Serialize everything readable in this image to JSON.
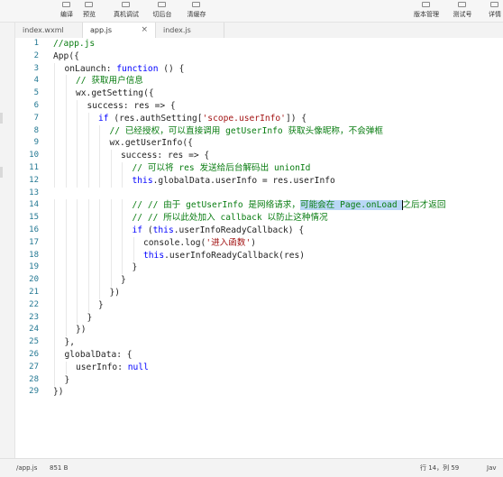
{
  "toolbar": {
    "left": [
      {
        "label": "编译",
        "icon": "compile-icon"
      },
      {
        "label": "预览",
        "icon": "preview-icon"
      },
      {
        "label": "真机调试",
        "icon": "debug-icon"
      },
      {
        "label": "切后台",
        "icon": "background-icon"
      },
      {
        "label": "清缓存",
        "icon": "clear-cache-icon"
      }
    ],
    "right": [
      {
        "label": "版本管理",
        "icon": "version-icon"
      },
      {
        "label": "测试号",
        "icon": "test-account-icon"
      },
      {
        "label": "详情",
        "icon": "details-icon"
      }
    ]
  },
  "tabs": [
    {
      "label": "index.wxml",
      "active": false
    },
    {
      "label": "app.js",
      "active": true,
      "close": "×"
    },
    {
      "label": "index.js",
      "active": false
    }
  ],
  "editor": {
    "lines": [
      {
        "n": "1",
        "indent": 0,
        "tokens": [
          {
            "t": "//app.js",
            "c": "comment"
          }
        ]
      },
      {
        "n": "2",
        "indent": 0,
        "tokens": [
          {
            "t": "App({",
            "c": "plain"
          }
        ]
      },
      {
        "n": "3",
        "indent": 1,
        "tokens": [
          {
            "t": "onLaunch: ",
            "c": "plain"
          },
          {
            "t": "function",
            "c": "keyword"
          },
          {
            "t": " () {",
            "c": "plain"
          }
        ]
      },
      {
        "n": "4",
        "indent": 2,
        "tokens": [
          {
            "t": "// 获取用户信息",
            "c": "comment"
          }
        ]
      },
      {
        "n": "5",
        "indent": 2,
        "tokens": [
          {
            "t": "wx.getSetting({",
            "c": "plain"
          }
        ]
      },
      {
        "n": "6",
        "indent": 3,
        "tokens": [
          {
            "t": "success: res => {",
            "c": "plain"
          }
        ]
      },
      {
        "n": "7",
        "indent": 4,
        "tokens": [
          {
            "t": "if",
            "c": "keyword"
          },
          {
            "t": " (res.authSetting[",
            "c": "plain"
          },
          {
            "t": "'scope.userInfo'",
            "c": "string"
          },
          {
            "t": "]) {",
            "c": "plain"
          }
        ]
      },
      {
        "n": "8",
        "indent": 5,
        "tokens": [
          {
            "t": "// 已经授权，可以直接调用 getUserInfo 获取头像昵称，不会弹框",
            "c": "comment"
          }
        ]
      },
      {
        "n": "9",
        "indent": 5,
        "tokens": [
          {
            "t": "wx.getUserInfo({",
            "c": "plain"
          }
        ]
      },
      {
        "n": "10",
        "indent": 6,
        "tokens": [
          {
            "t": "success: res => {",
            "c": "plain"
          }
        ]
      },
      {
        "n": "11",
        "indent": 7,
        "tokens": [
          {
            "t": "// 可以将 res 发送给后台解码出 unionId",
            "c": "comment"
          }
        ]
      },
      {
        "n": "12",
        "indent": 7,
        "tokens": [
          {
            "t": "this",
            "c": "keyword"
          },
          {
            "t": ".globalData.userInfo = res.userInfo",
            "c": "plain"
          }
        ]
      },
      {
        "n": "13",
        "indent": 0,
        "tokens": []
      },
      {
        "n": "14",
        "indent": 7,
        "tokens": [
          {
            "t": "// // 由于 getUserInfo 是网络请求，",
            "c": "comment"
          },
          {
            "t": "可能会在 Page.onLoad ",
            "c": "comment",
            "hl": true
          },
          {
            "caret": true
          },
          {
            "t": "之后才返回",
            "c": "comment"
          }
        ]
      },
      {
        "n": "15",
        "indent": 7,
        "tokens": [
          {
            "t": "// // 所以此处加入 callback 以防止这种情况",
            "c": "comment"
          }
        ]
      },
      {
        "n": "16",
        "indent": 7,
        "tokens": [
          {
            "t": "if",
            "c": "keyword"
          },
          {
            "t": " (",
            "c": "plain"
          },
          {
            "t": "this",
            "c": "keyword"
          },
          {
            "t": ".userInfoReadyCallback) {",
            "c": "plain"
          }
        ]
      },
      {
        "n": "17",
        "indent": 8,
        "tokens": [
          {
            "t": "console.log(",
            "c": "plain"
          },
          {
            "t": "'进入函数'",
            "c": "string"
          },
          {
            "t": ")",
            "c": "plain"
          }
        ]
      },
      {
        "n": "18",
        "indent": 8,
        "tokens": [
          {
            "t": "this",
            "c": "keyword"
          },
          {
            "t": ".userInfoReadyCallback(res)",
            "c": "plain"
          }
        ]
      },
      {
        "n": "19",
        "indent": 7,
        "tokens": [
          {
            "t": "}",
            "c": "plain"
          }
        ]
      },
      {
        "n": "20",
        "indent": 6,
        "tokens": [
          {
            "t": "}",
            "c": "plain"
          }
        ]
      },
      {
        "n": "21",
        "indent": 5,
        "tokens": [
          {
            "t": "})",
            "c": "plain"
          }
        ]
      },
      {
        "n": "22",
        "indent": 4,
        "tokens": [
          {
            "t": "}",
            "c": "plain"
          }
        ]
      },
      {
        "n": "23",
        "indent": 3,
        "tokens": [
          {
            "t": "}",
            "c": "plain"
          }
        ]
      },
      {
        "n": "24",
        "indent": 2,
        "tokens": [
          {
            "t": "})",
            "c": "plain"
          }
        ]
      },
      {
        "n": "25",
        "indent": 1,
        "tokens": [
          {
            "t": "},",
            "c": "plain"
          }
        ]
      },
      {
        "n": "26",
        "indent": 1,
        "tokens": [
          {
            "t": "globalData: {",
            "c": "plain"
          }
        ]
      },
      {
        "n": "27",
        "indent": 2,
        "tokens": [
          {
            "t": "userInfo: ",
            "c": "plain"
          },
          {
            "t": "null",
            "c": "keyword"
          }
        ]
      },
      {
        "n": "28",
        "indent": 1,
        "tokens": [
          {
            "t": "}",
            "c": "plain"
          }
        ]
      },
      {
        "n": "29",
        "indent": 0,
        "tokens": [
          {
            "t": "})",
            "c": "plain"
          }
        ]
      }
    ]
  },
  "status": {
    "path": "/app.js",
    "size": "851 B",
    "cursor": "行 14，列 59",
    "lang": "Jav"
  }
}
